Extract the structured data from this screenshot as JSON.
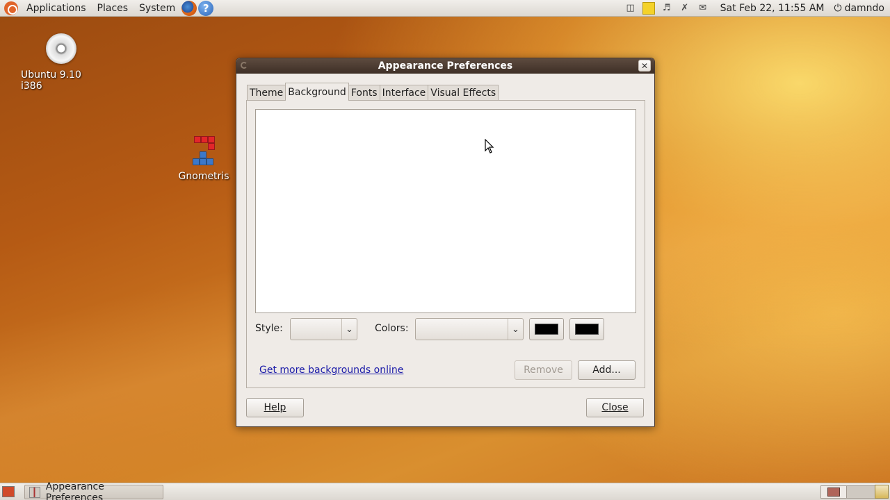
{
  "top_panel": {
    "menus": [
      "Applications",
      "Places",
      "System"
    ],
    "clock": "Sat Feb 22, 11:55 AM",
    "user": "damndo",
    "launchers": [
      "firefox-icon",
      "help-icon"
    ],
    "tray_icons": [
      "storage-icon",
      "notes-icon",
      "volume-icon",
      "network-icon",
      "mail-icon"
    ]
  },
  "desktop": {
    "icons": [
      {
        "label": "Ubuntu 9.10 i386",
        "icon": "cd-icon"
      },
      {
        "label": "Gnometris",
        "icon": "gnometris-icon"
      }
    ]
  },
  "dialog": {
    "title": "Appearance Preferences",
    "tabs": [
      "Theme",
      "Background",
      "Fonts",
      "Interface",
      "Visual Effects"
    ],
    "active_tab": "Background",
    "style_label": "Style:",
    "style_value": "",
    "colors_label": "Colors:",
    "colors_value": "",
    "color1": "#000000",
    "color2": "#000000",
    "more_link": "Get more backgrounds online",
    "remove_label": "Remove",
    "add_label": "Add...",
    "help_label": "Help",
    "close_label": "Close"
  },
  "bottom_panel": {
    "task_label": "Appearance Preferences"
  }
}
